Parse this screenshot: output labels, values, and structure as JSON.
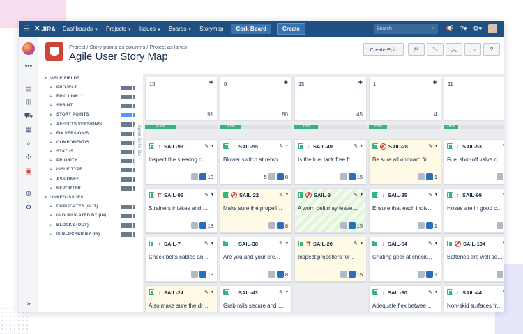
{
  "topnav": {
    "logo": "JIRA",
    "items": [
      {
        "label": "Dashboards",
        "caret": true
      },
      {
        "label": "Projects",
        "caret": true
      },
      {
        "label": "Issues",
        "caret": true
      },
      {
        "label": "Boards",
        "caret": true
      },
      {
        "label": "Storymap",
        "caret": false
      }
    ],
    "board_button": "Cork Board",
    "create_button": "Create",
    "search_placeholder": "Search"
  },
  "header": {
    "breadcrumb": "Project / Story points as columns / Project as lanes",
    "title": "Agile User Story Map",
    "create_epic": "Create Epic"
  },
  "fields": {
    "heading": "ISSUE FIELDS",
    "items": [
      "PROJECT",
      "EPIC LINK",
      "SPRINT",
      "STORY POINTS",
      "AFFECTS VERSION/S",
      "FIX VERSION/S",
      "COMPONENT/S",
      "STATUS",
      "PRIORITY",
      "ISSUE TYPE",
      "ASSIGNEE",
      "REPORTER"
    ],
    "linked_heading": "LINKED ISSUES",
    "linked_items": [
      "DUPLICATES (OUT)",
      "IS DUPLICATED BY (IN)",
      "BLOCKS (OUT)",
      "IS BLOCKED BY (IN)"
    ]
  },
  "sprint_tab": "Sprint Sprint Sta",
  "columns": [
    {
      "points": "13",
      "total": "91",
      "progress": "43%",
      "progress_value": 43
    },
    {
      "points": "8",
      "total": "80",
      "progress": "30%",
      "progress_value": 30
    },
    {
      "points": "15",
      "total": "45",
      "progress": "33%",
      "progress_value": 33
    },
    {
      "points": "1",
      "total": "4",
      "progress": "25%",
      "progress_value": 25
    },
    {
      "points": "11",
      "total": "",
      "progress": "20%",
      "progress_value": 20
    }
  ],
  "cards": [
    [
      {
        "key": "SAIL-93",
        "priority": "up",
        "summary": "Inspect the steering c…",
        "count": "13",
        "bg": "white"
      },
      {
        "key": "SAIL-96",
        "priority": "highest",
        "summary": "Strainers intakes and …",
        "count": "13",
        "bg": "white"
      },
      {
        "key": "SAIL-7",
        "priority": "up",
        "summary": "Check belts cables an…",
        "count": "13",
        "bg": "white"
      },
      {
        "key": "SAIL-24",
        "priority": "down",
        "summary": "Also make sure the dr…",
        "count": "",
        "bg": "yellow"
      }
    ],
    [
      {
        "key": "SAIL-55",
        "priority": "up",
        "summary": "Blower switch at remo…",
        "count": "8",
        "pre": "5",
        "bg": "white"
      },
      {
        "key": "SAIL-22",
        "priority": "blocker",
        "summary": "Make sure the propell…",
        "count": "8",
        "bg": "yellow"
      },
      {
        "key": "SAIL-38",
        "priority": "down",
        "summary": "Are you and your cre…",
        "count": "8",
        "bg": "white"
      },
      {
        "key": "SAIL-43",
        "priority": "up",
        "summary": "Grab rails secure and …",
        "count": "",
        "bg": "white"
      }
    ],
    [
      {
        "key": "SAIL-49",
        "priority": "down",
        "summary": "Is the fuel tank free fr…",
        "count": "15",
        "bg": "white"
      },
      {
        "key": "SAIL-9",
        "priority": "blocker",
        "summary": "A worn belt may leave…",
        "count": "15",
        "bg": "striped"
      },
      {
        "key": "SAIL-20",
        "priority": "highest",
        "summary": "Inspect propellers for …",
        "count": "15",
        "bg": "yellow"
      }
    ],
    [
      {
        "key": "SAIL-28",
        "priority": "blocker",
        "summary": "Be sure all onboard fir…",
        "count": "1",
        "bg": "yellow"
      },
      {
        "key": "SAIL-35",
        "priority": "down",
        "summary": "Ensure that each indiv…",
        "count": "1",
        "bg": "white"
      },
      {
        "key": "SAIL-64",
        "priority": "down",
        "summary": "Chafing gear at check…",
        "count": "1",
        "bg": "white"
      },
      {
        "key": "SAIL-80",
        "priority": "up",
        "summary": "Adequate flex betwee…",
        "count": "",
        "bg": "white"
      }
    ],
    [
      {
        "key": "SAIL-53",
        "priority": "down",
        "summary": "Fuel shut-off valve c…",
        "count": "",
        "bg": "white"
      },
      {
        "key": "SAIL-99",
        "priority": "up",
        "summary": "Hoses are in good c…",
        "count": "",
        "bg": "white"
      },
      {
        "key": "SAIL-104",
        "priority": "blocker",
        "summary": "Batteries are well se…",
        "count": "",
        "bg": "white"
      },
      {
        "key": "SAIL-44",
        "priority": "down",
        "summary": "Non-skid surfaces fr…",
        "count": "",
        "bg": "white"
      }
    ]
  ]
}
